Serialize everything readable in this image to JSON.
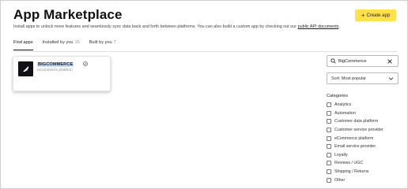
{
  "header": {
    "title": "App Marketplace",
    "subtitle_text": "Install apps to unlock more features and seamlessly sync data back and forth between platforms. You can also build a custom app by checking out our ",
    "subtitle_link": "public API documents",
    "subtitle_end": ".",
    "create_button_label": "Create app",
    "create_button_icon": "plus-icon",
    "accent_color": "#ffe14d"
  },
  "tabs": [
    {
      "label": "Find apps",
      "count": "",
      "active": true
    },
    {
      "label": "Installed by you",
      "count": "15",
      "active": false
    },
    {
      "label": "Built by you",
      "count": "7",
      "active": false
    }
  ],
  "results": [
    {
      "name": "BIGCOMMERCE",
      "category": "eCommerce platform",
      "logo_icon": "bigcommerce-logo-icon",
      "verified_icon": "verified-badge-icon"
    }
  ],
  "search": {
    "value": "BigCommerce",
    "placeholder": "Search apps",
    "icon": "search-icon",
    "clear_icon": "close-icon"
  },
  "sort": {
    "selected": "Sort: Most popular",
    "icon": "chevron-down-icon"
  },
  "categories": {
    "heading": "Categories",
    "items": [
      "Analytics",
      "Automation",
      "Customer data platform",
      "Customer service provider",
      "eCommerce platform",
      "Email service provider",
      "Loyalty",
      "Reviews / UGC",
      "Shipping / Returns",
      "Other"
    ]
  }
}
